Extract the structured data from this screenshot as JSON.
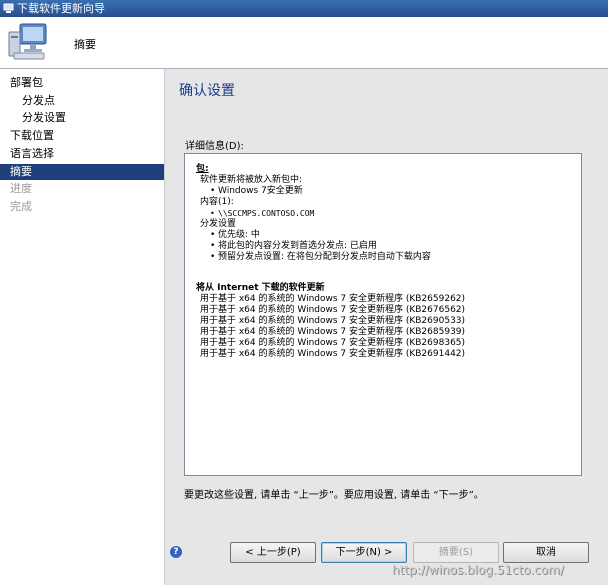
{
  "window": {
    "title": "下载软件更新向导"
  },
  "header": {
    "title": "摘要"
  },
  "nav": {
    "items": [
      {
        "label": "部署包",
        "state": "normal"
      },
      {
        "label": "分发点",
        "state": "normal"
      },
      {
        "label": "分发设置",
        "state": "normal"
      },
      {
        "label": "下载位置",
        "state": "normal"
      },
      {
        "label": "语言选择",
        "state": "normal"
      },
      {
        "label": "摘要",
        "state": "selected"
      },
      {
        "label": "进度",
        "state": "disabled"
      },
      {
        "label": "完成",
        "state": "disabled"
      }
    ]
  },
  "main": {
    "title": "确认设置",
    "details_label": "详细信息(D):",
    "details": {
      "package_heading": "包:",
      "package_desc": "软件更新将被放入新包中:",
      "package_name": "Windows 7安全更新",
      "content_heading": "内容(1):",
      "content_path": "\\\\SCCMPS.CONTOSO.COM",
      "dist_heading": "分发设置",
      "dist_items": [
        "优先级: 中",
        "将此包的内容分发到首选分发点: 已启用",
        "预留分发点设置: 在将包分配到分发点时自动下载内容"
      ],
      "download_heading": "将从 Internet 下载的软件更新",
      "updates": [
        "用于基于 x64 的系统的 Windows 7 安全更新程序 (KB2659262)",
        "用于基于 x64 的系统的 Windows 7 安全更新程序 (KB2676562)",
        "用于基于 x64 的系统的 Windows 7 安全更新程序 (KB2690533)",
        "用于基于 x64 的系统的 Windows 7 安全更新程序 (KB2685939)",
        "用于基于 x64 的系统的 Windows 7 安全更新程序 (KB2698365)",
        "用于基于 x64 的系统的 Windows 7 安全更新程序 (KB2691442)"
      ]
    },
    "footer_note": "要更改这些设置, 请单击 “上一步”。要应用设置, 请单击 “下一步”。"
  },
  "buttons": {
    "back": "< 上一步(P)",
    "next": "下一步(N) >",
    "summary": "摘要(S)",
    "cancel": "取消"
  },
  "watermark": "http://winos.blog.51cto.com/",
  "colors": {
    "selected_nav": "#1f3f7a",
    "title_blue": "#1a3e8c",
    "panel_bg": "#e6e6e6"
  }
}
